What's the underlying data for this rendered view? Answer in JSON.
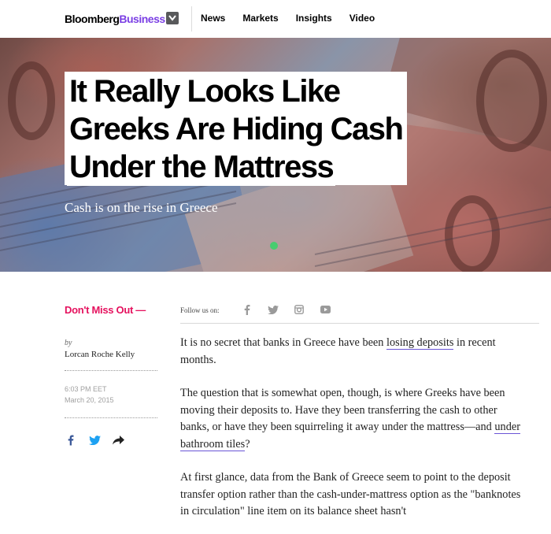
{
  "header": {
    "logo_part1": "Bloomberg",
    "logo_part2": "Business",
    "nav": [
      "News",
      "Markets",
      "Insights",
      "Video"
    ]
  },
  "hero": {
    "headline_lines": [
      "It Really Looks Like",
      "Greeks Are Hiding Cash",
      "Under the Mattress"
    ],
    "dek": "Cash is on the rise in Greece"
  },
  "social": {
    "dont_miss": "Don't Miss Out —",
    "follow_label": "Follow us on:",
    "follow_icons": [
      "facebook-icon",
      "twitter-icon",
      "instagram-icon",
      "youtube-icon"
    ]
  },
  "byline": {
    "by": "by",
    "author": "Lorcan Roche Kelly",
    "time": "6:03 PM EET",
    "date": "March 20, 2015"
  },
  "article": {
    "p1_pre": "It is no secret that banks in Greece have been ",
    "p1_link": "losing deposits",
    "p1_post": " in recent months.",
    "p2_pre": "The question that is somewhat open, though, is where Greeks have been moving their deposits to. Have they been transferring the cash to other banks, or have they been squirreling it away under the mattress—and ",
    "p2_link": "under bathroom tiles",
    "p2_post": "?",
    "p3": "At first glance, data from the Bank of Greece seem to point to the deposit transfer option rather than the cash-under-mattress option as the \"banknotes in circulation\" line item on its balance sheet hasn't"
  },
  "colors": {
    "accent_pink": "#e5115e",
    "logo_purple": "#7b3fe4",
    "link_underline": "#6a55d6",
    "facebook_blue": "#3b5998",
    "twitter_blue": "#1da1f2"
  }
}
